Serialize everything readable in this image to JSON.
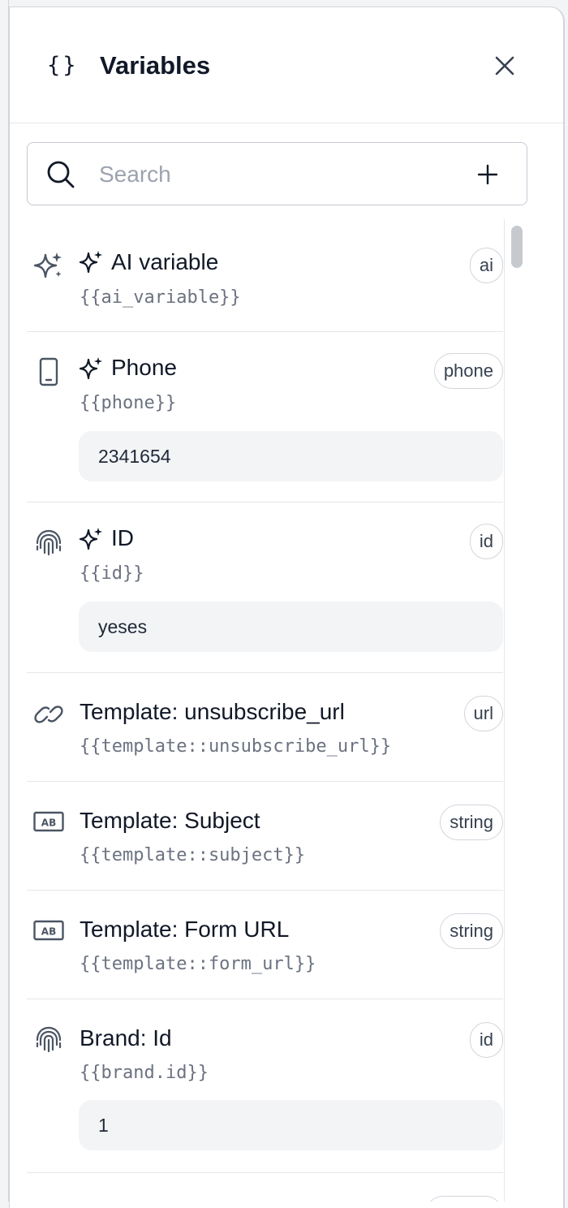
{
  "panel": {
    "title": "Variables"
  },
  "search": {
    "placeholder": "Search"
  },
  "icons": {
    "header": "braces-icon",
    "close": "close-icon",
    "search": "search-icon",
    "add": "plus-icon",
    "ai_indicator": "sparkles-icon"
  },
  "colors": {
    "icon_slate": "#4b5563",
    "badge_border": "#d1d5db",
    "value_bg": "#f3f4f6",
    "key_text": "#6b7280"
  },
  "variables": [
    {
      "name": "AI variable",
      "key": "{{ai_variable}}",
      "badge": "ai",
      "icon": "sparkles-icon",
      "ai": true,
      "value": null
    },
    {
      "name": "Phone",
      "key": "{{phone}}",
      "badge": "phone",
      "icon": "phone-icon",
      "ai": true,
      "value": "2341654"
    },
    {
      "name": "ID",
      "key": "{{id}}",
      "badge": "id",
      "icon": "fingerprint-icon",
      "ai": true,
      "value": "yeses"
    },
    {
      "name": "Template: unsubscribe_url",
      "key": "{{template::unsubscribe_url}}",
      "badge": "url",
      "icon": "link-icon",
      "ai": false,
      "value": null
    },
    {
      "name": "Template: Subject",
      "key": "{{template::subject}}",
      "badge": "string",
      "icon": "text-ab-icon",
      "ai": false,
      "value": null
    },
    {
      "name": "Template: Form URL",
      "key": "{{template::form_url}}",
      "badge": "string",
      "icon": "text-ab-icon",
      "ai": false,
      "value": null
    },
    {
      "name": "Brand: Id",
      "key": "{{brand.id}}",
      "badge": "id",
      "icon": "fingerprint-icon",
      "ai": false,
      "value": "1"
    }
  ]
}
